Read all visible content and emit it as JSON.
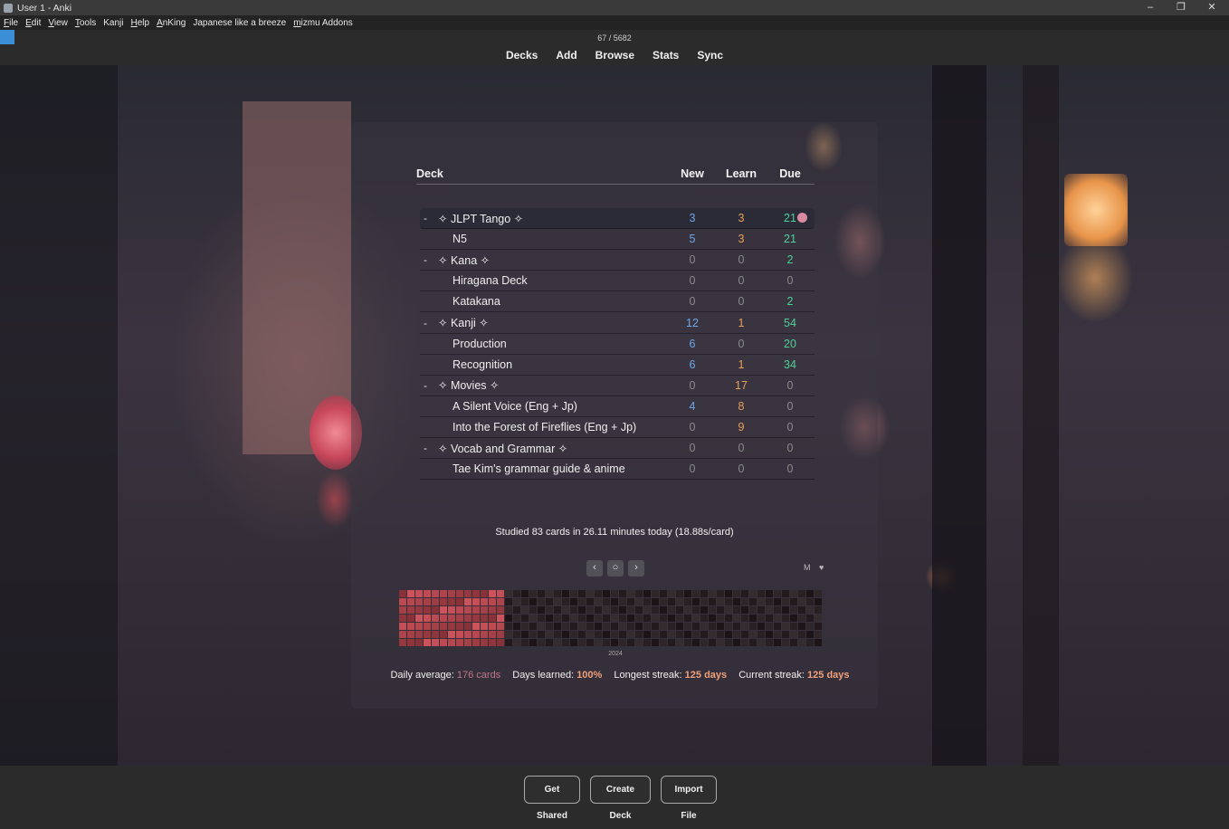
{
  "window": {
    "title": "User 1 - Anki",
    "minimize": "–",
    "restore": "❐",
    "close": "✕"
  },
  "menu": [
    {
      "first": "F",
      "rest": "ile"
    },
    {
      "first": "E",
      "rest": "dit"
    },
    {
      "first": "V",
      "rest": "iew"
    },
    {
      "first": "T",
      "rest": "ools"
    },
    {
      "first": "",
      "rest": "Kanji"
    },
    {
      "first": "H",
      "rest": "elp"
    },
    {
      "first": "A",
      "rest": "nKing"
    },
    {
      "first": "",
      "rest": "Japanese like a breeze"
    },
    {
      "first": "m",
      "rest": "izmu Addons"
    }
  ],
  "toolbar": {
    "counter": "67 / 5682",
    "nav": [
      "Decks",
      "Add",
      "Browse",
      "Stats",
      "Sync"
    ]
  },
  "deck_table": {
    "headers": {
      "deck": "Deck",
      "new": "New",
      "learn": "Learn",
      "due": "Due"
    },
    "colors": {
      "new": "#6ea8e8",
      "learn": "#e8a05a",
      "due": "#4fcf9a",
      "zero": "#8a8a8a"
    },
    "rows": [
      {
        "collapse": "-",
        "name": "✧ JLPT Tango ✧",
        "new": "3",
        "learn": "3",
        "due": "21",
        "indent": 0,
        "current": true
      },
      {
        "collapse": "",
        "name": "N5",
        "new": "5",
        "learn": "3",
        "due": "21",
        "indent": 1
      },
      {
        "collapse": "-",
        "name": "✧ Kana ✧",
        "new": "0",
        "learn": "0",
        "due": "2",
        "indent": 0
      },
      {
        "collapse": "",
        "name": "Hiragana Deck",
        "new": "0",
        "learn": "0",
        "due": "0",
        "indent": 1
      },
      {
        "collapse": "",
        "name": "Katakana",
        "new": "0",
        "learn": "0",
        "due": "2",
        "indent": 1
      },
      {
        "collapse": "-",
        "name": "✧ Kanji ✧",
        "new": "12",
        "learn": "1",
        "due": "54",
        "indent": 0
      },
      {
        "collapse": "",
        "name": "Production",
        "new": "6",
        "learn": "0",
        "due": "20",
        "indent": 1
      },
      {
        "collapse": "",
        "name": "Recognition",
        "new": "6",
        "learn": "1",
        "due": "34",
        "indent": 1
      },
      {
        "collapse": "-",
        "name": "✧ Movies ✧",
        "new": "0",
        "learn": "17",
        "due": "0",
        "indent": 0
      },
      {
        "collapse": "",
        "name": "A Silent Voice (Eng + Jp)",
        "new": "4",
        "learn": "8",
        "due": "0",
        "indent": 1
      },
      {
        "collapse": "",
        "name": "Into the Forest of Fireflies (Eng + Jp)",
        "new": "0",
        "learn": "9",
        "due": "0",
        "indent": 1
      },
      {
        "collapse": "-",
        "name": "✧ Vocab and Grammar ✧",
        "new": "0",
        "learn": "0",
        "due": "0",
        "indent": 0
      },
      {
        "collapse": "",
        "name": "Tae Kim's grammar guide & anime",
        "new": "0",
        "learn": "0",
        "due": "0",
        "indent": 1
      }
    ]
  },
  "studied": "Studied 83 cards in 26.11 minutes today (18.88s/card)",
  "heatmap": {
    "prev": "‹",
    "today": "○",
    "next": "›",
    "mode_icon": "M",
    "heart_icon": "♥",
    "year": "2024",
    "active_weeks": 13,
    "stats": {
      "daily_average_label": "Daily average:",
      "daily_average_value": "176 cards",
      "days_learned_label": "Days learned:",
      "days_learned_value": "100%",
      "longest_streak_label": "Longest streak:",
      "longest_streak_value": "125 days",
      "current_streak_label": "Current streak:",
      "current_streak_value": "125 days"
    }
  },
  "bottom_buttons": [
    "Get Shared",
    "Create Deck",
    "Import File"
  ]
}
